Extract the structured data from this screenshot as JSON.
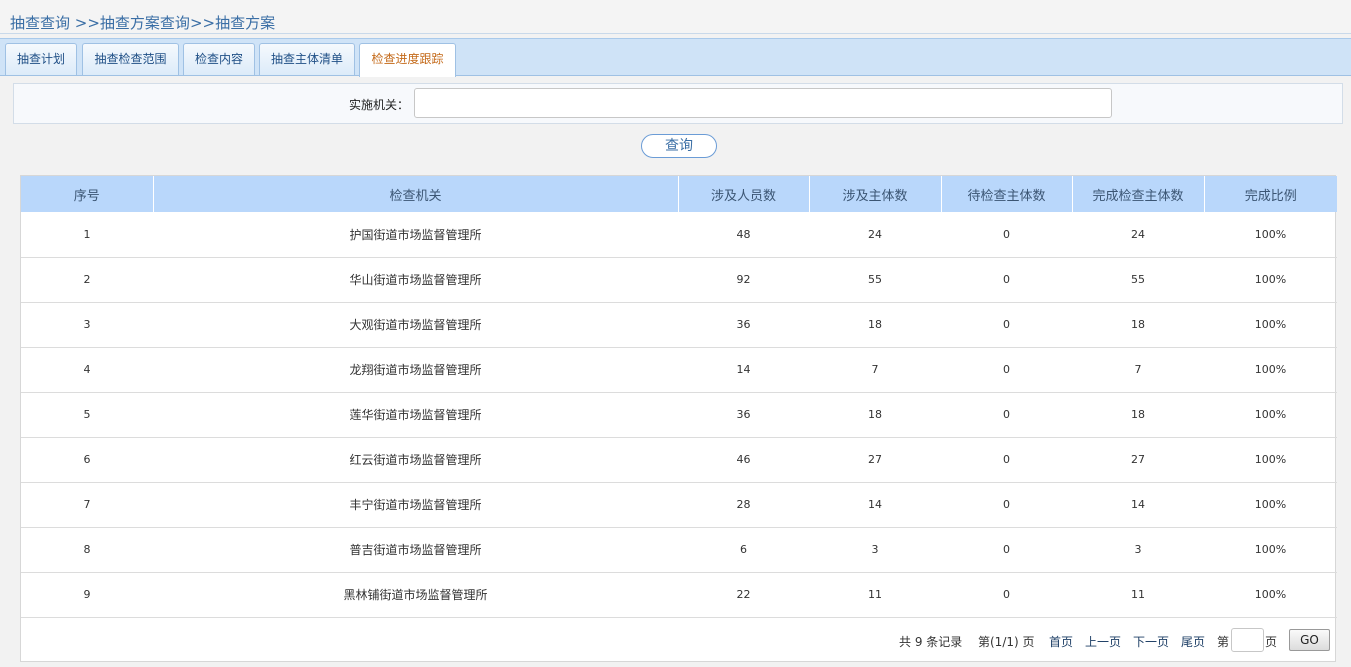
{
  "breadcrumb": {
    "level1": "抽查查询",
    "sep1": " >>",
    "level2": "抽查方案查询",
    "sep2": ">>",
    "level3": "抽查方案"
  },
  "tabs": [
    {
      "label": "抽查计划",
      "active": false
    },
    {
      "label": "抽查检查范围",
      "active": false
    },
    {
      "label": "检查内容",
      "active": false
    },
    {
      "label": "抽查主体清单",
      "active": false
    },
    {
      "label": "检查进度跟踪",
      "active": true
    }
  ],
  "filter": {
    "label": "实施机关：",
    "value": "",
    "placeholder": ""
  },
  "query_button": "查询",
  "table": {
    "headers": [
      "序号",
      "检查机关",
      "涉及人员数",
      "涉及主体数",
      "待检查主体数",
      "完成检查主体数",
      "完成比例"
    ],
    "rows": [
      [
        "1",
        "护国街道市场监督管理所",
        "48",
        "24",
        "0",
        "24",
        "100%"
      ],
      [
        "2",
        "华山街道市场监督管理所",
        "92",
        "55",
        "0",
        "55",
        "100%"
      ],
      [
        "3",
        "大观街道市场监督管理所",
        "36",
        "18",
        "0",
        "18",
        "100%"
      ],
      [
        "4",
        "龙翔街道市场监督管理所",
        "14",
        "7",
        "0",
        "7",
        "100%"
      ],
      [
        "5",
        "莲华街道市场监督管理所",
        "36",
        "18",
        "0",
        "18",
        "100%"
      ],
      [
        "6",
        "红云街道市场监督管理所",
        "46",
        "27",
        "0",
        "27",
        "100%"
      ],
      [
        "7",
        "丰宁街道市场监督管理所",
        "28",
        "14",
        "0",
        "14",
        "100%"
      ],
      [
        "8",
        "普吉街道市场监督管理所",
        "6",
        "3",
        "0",
        "3",
        "100%"
      ],
      [
        "9",
        "黑林铺街道市场监督管理所",
        "22",
        "11",
        "0",
        "11",
        "100%"
      ]
    ]
  },
  "pager": {
    "total": "共 9 条记录",
    "page_info": "第(1/1) 页",
    "first": "首页",
    "prev": "上一页",
    "next": "下一页",
    "last": "尾页",
    "goto_prefix": "第",
    "goto_suffix": "页",
    "goto_value": "",
    "go_button": "GO"
  }
}
